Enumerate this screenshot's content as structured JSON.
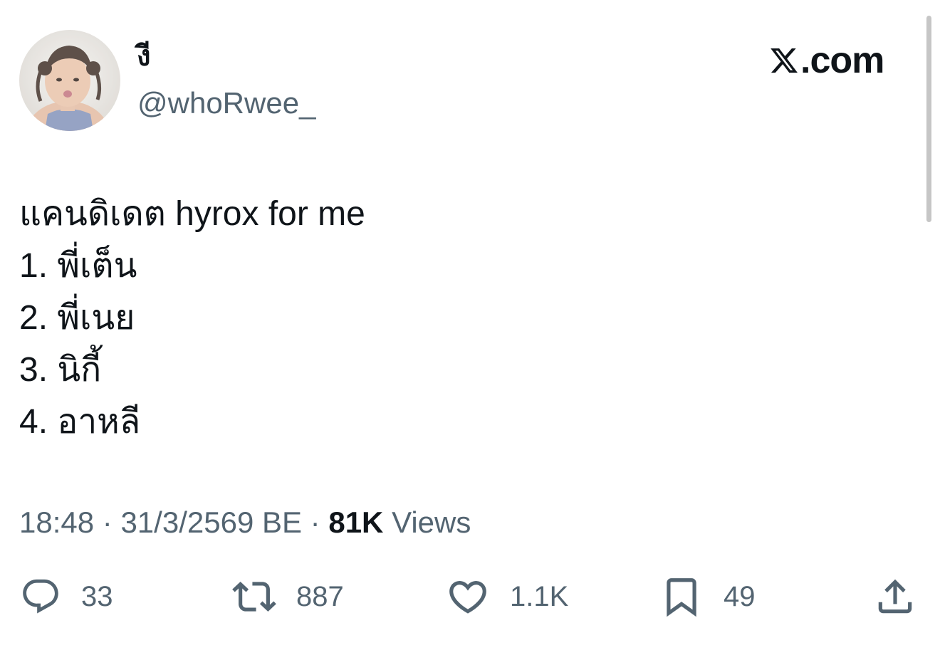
{
  "author": {
    "display_name": "งี",
    "handle": "@whoRwee_",
    "avatar_icon": "profile-photo"
  },
  "brand": {
    "icon": "x-logo-icon",
    "suffix": ".com"
  },
  "tweet": {
    "lines": [
      "แคนดิเดต hyrox for me",
      "1. พี่เต็น",
      "2. พี่เนย",
      "3. นิกี้",
      "4. อาหลี"
    ],
    "time": "18:48",
    "separator": "·",
    "date": "31/3/2569 BE",
    "views_count": "81K",
    "views_label": "Views"
  },
  "actions": {
    "reply": {
      "icon": "reply-icon",
      "count": "33"
    },
    "retweet": {
      "icon": "retweet-icon",
      "count": "887"
    },
    "like": {
      "icon": "heart-icon",
      "count": "1.1K"
    },
    "bookmark": {
      "icon": "bookmark-icon",
      "count": "49"
    },
    "share": {
      "icon": "share-icon"
    }
  },
  "colors": {
    "text_primary": "#0f1419",
    "text_secondary": "#536471",
    "background": "#ffffff"
  }
}
